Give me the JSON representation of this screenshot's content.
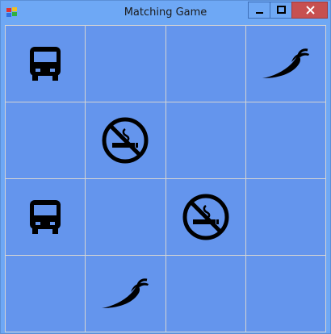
{
  "window": {
    "title": "Matching Game",
    "app_icon": "windows-form-icon",
    "controls": {
      "minimize": "minimize-icon",
      "maximize": "maximize-icon",
      "close": "close-icon"
    }
  },
  "colors": {
    "titlebar": "#6ea8f5",
    "board": "#6495ed",
    "gridline": "#d4d4d4",
    "icon": "#000000",
    "close_button": "#c75050"
  },
  "board": {
    "rows": 4,
    "columns": 4,
    "cells": [
      [
        "bus",
        "",
        "",
        "chili-pepper"
      ],
      [
        "",
        "no-smoking",
        "",
        ""
      ],
      [
        "bus",
        "",
        "no-smoking",
        ""
      ],
      [
        "",
        "chili-pepper",
        "",
        ""
      ]
    ]
  }
}
